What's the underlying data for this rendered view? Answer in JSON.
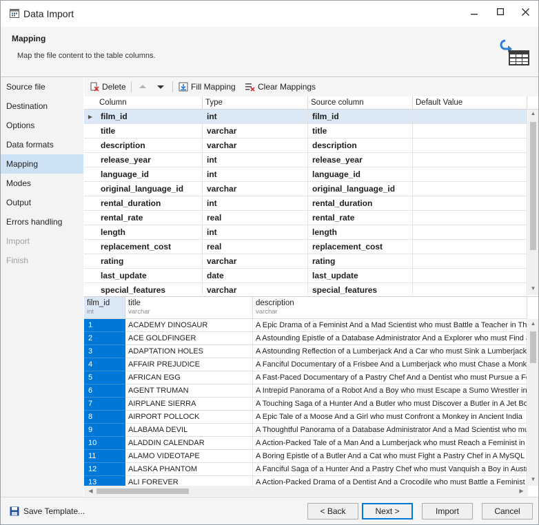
{
  "window": {
    "title": "Data Import"
  },
  "header": {
    "title": "Mapping",
    "subtitle": "Map the file content to the table columns."
  },
  "sidebar": {
    "items": [
      {
        "label": "Source file",
        "state": "normal"
      },
      {
        "label": "Destination",
        "state": "normal"
      },
      {
        "label": "Options",
        "state": "normal"
      },
      {
        "label": "Data formats",
        "state": "normal"
      },
      {
        "label": "Mapping",
        "state": "active"
      },
      {
        "label": "Modes",
        "state": "normal"
      },
      {
        "label": "Output",
        "state": "normal"
      },
      {
        "label": "Errors handling",
        "state": "normal"
      },
      {
        "label": "Import",
        "state": "disabled"
      },
      {
        "label": "Finish",
        "state": "disabled"
      }
    ]
  },
  "toolbar": {
    "delete_label": "Delete",
    "fill_label": "Fill Mapping",
    "clear_label": "Clear Mappings"
  },
  "mapping": {
    "headers": [
      "Column",
      "Type",
      "Source column",
      "Default Value"
    ],
    "rows": [
      {
        "column": "film_id",
        "type": "int",
        "source": "film_id",
        "default": ""
      },
      {
        "column": "title",
        "type": "varchar",
        "source": "title",
        "default": ""
      },
      {
        "column": "description",
        "type": "varchar",
        "source": "description",
        "default": ""
      },
      {
        "column": "release_year",
        "type": "int",
        "source": "release_year",
        "default": ""
      },
      {
        "column": "language_id",
        "type": "int",
        "source": "language_id",
        "default": ""
      },
      {
        "column": "original_language_id",
        "type": "varchar",
        "source": "original_language_id",
        "default": ""
      },
      {
        "column": "rental_duration",
        "type": "int",
        "source": "rental_duration",
        "default": ""
      },
      {
        "column": "rental_rate",
        "type": "real",
        "source": "rental_rate",
        "default": ""
      },
      {
        "column": "length",
        "type": "int",
        "source": "length",
        "default": ""
      },
      {
        "column": "replacement_cost",
        "type": "real",
        "source": "replacement_cost",
        "default": ""
      },
      {
        "column": "rating",
        "type": "varchar",
        "source": "rating",
        "default": ""
      },
      {
        "column": "last_update",
        "type": "date",
        "source": "last_update",
        "default": ""
      },
      {
        "column": "special_features",
        "type": "varchar",
        "source": "special_features",
        "default": ""
      }
    ]
  },
  "preview": {
    "columns": [
      {
        "name": "film_id",
        "type": "int"
      },
      {
        "name": "title",
        "type": "varchar"
      },
      {
        "name": "description",
        "type": "varchar"
      }
    ],
    "rows": [
      {
        "id": "1",
        "title": "ACADEMY DINOSAUR",
        "description": "A Epic Drama of a Feminist And a Mad Scientist who must Battle a Teacher in The Canadian Rockies"
      },
      {
        "id": "2",
        "title": "ACE GOLDFINGER",
        "description": "A Astounding Epistle of a Database Administrator And a Explorer who must Find a Car in Ancient China"
      },
      {
        "id": "3",
        "title": "ADAPTATION HOLES",
        "description": "A Astounding Reflection of a Lumberjack And a Car who must Sink a Lumberjack in A Baloon Factory"
      },
      {
        "id": "4",
        "title": "AFFAIR PREJUDICE",
        "description": "A Fanciful Documentary of a Frisbee And a Lumberjack who must Chase a Monkey in A Shark Tank"
      },
      {
        "id": "5",
        "title": "AFRICAN EGG",
        "description": "A Fast-Paced Documentary of a Pastry Chef And a Dentist who must Pursue a Forensic Psychologist"
      },
      {
        "id": "6",
        "title": "AGENT TRUMAN",
        "description": "A Intrepid Panorama of a Robot And a Boy who must Escape a Sumo Wrestler in Ancient China"
      },
      {
        "id": "7",
        "title": "AIRPLANE SIERRA",
        "description": "A Touching Saga of a Hunter And a Butler who must Discover a Butler in A Jet Boat"
      },
      {
        "id": "8",
        "title": "AIRPORT POLLOCK",
        "description": "A Epic Tale of a Moose And a Girl who must Confront a Monkey in Ancient India"
      },
      {
        "id": "9",
        "title": "ALABAMA DEVIL",
        "description": "A Thoughtful Panorama of a Database Administrator And a Mad Scientist who must Outgun a Mad Scientist"
      },
      {
        "id": "10",
        "title": "ALADDIN CALENDAR",
        "description": "A Action-Packed Tale of a Man And a Lumberjack who must Reach a Feminist in Ancient China"
      },
      {
        "id": "11",
        "title": "ALAMO VIDEOTAPE",
        "description": "A Boring Epistle of a Butler And a Cat who must Fight a Pastry Chef in A MySQL Convention"
      },
      {
        "id": "12",
        "title": "ALASKA PHANTOM",
        "description": "A Fanciful Saga of a Hunter And a Pastry Chef who must Vanquish a Boy in Australia"
      },
      {
        "id": "13",
        "title": "ALI FOREVER",
        "description": "A Action-Packed Drama of a Dentist And a Crocodile who must Battle a Feminist in The Canadian Rockies"
      }
    ]
  },
  "footer": {
    "save_template": "Save Template...",
    "back": "< Back",
    "next": "Next >",
    "import": "Import",
    "cancel": "Cancel"
  },
  "colors": {
    "accent": "#0078d7",
    "selection": "#dbe8f6",
    "sidebar_active": "#cde1f5"
  }
}
